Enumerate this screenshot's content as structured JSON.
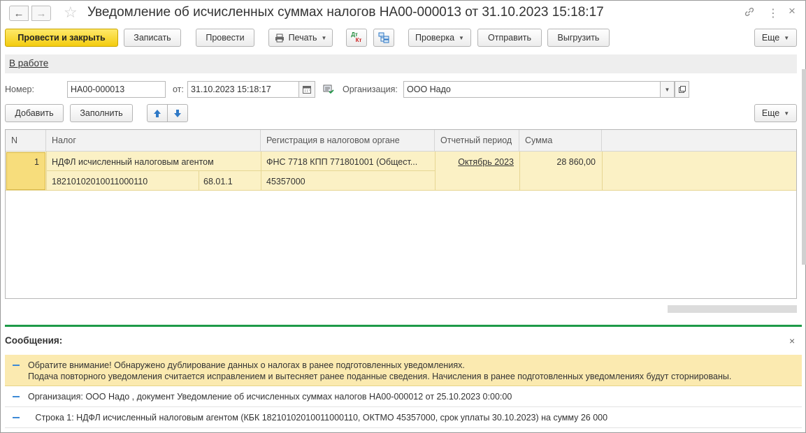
{
  "window": {
    "title": "Уведомление об исчисленных суммах налогов НА00-000013 от 31.10.2023 15:18:17",
    "back_icon": "←",
    "forward_icon": "→",
    "star_icon": "☆",
    "link_icon": "🔗",
    "menu_icon": "⋮",
    "close_icon": "×"
  },
  "toolbar": {
    "post_and_close": "Провести и закрыть",
    "save": "Записать",
    "post": "Провести",
    "print": "Печать",
    "dtkt_top": "Дт",
    "dtkt_bottom": "Кт",
    "check": "Проверка",
    "send": "Отправить",
    "export": "Выгрузить",
    "more": "Еще"
  },
  "status": {
    "label": "В работе"
  },
  "form": {
    "number_label": "Номер:",
    "number_value": "НА00-000013",
    "date_label": "от:",
    "date_value": "31.10.2023 15:18:17",
    "org_label": "Организация:",
    "org_value": "ООО Надо"
  },
  "table_toolbar": {
    "add": "Добавить",
    "fill": "Заполнить",
    "more": "Еще"
  },
  "table": {
    "columns": [
      "N",
      "Налог",
      "Регистрация в налоговом органе",
      "Отчетный период",
      "Сумма"
    ],
    "rows": [
      {
        "n": "1",
        "tax": "НДФЛ исчисленный налоговым агентом",
        "kbk": "18210102010011000110",
        "account": "68.01.1",
        "registration": "ФНС 7718 КПП 771801001 (Общест...",
        "oktmo": "45357000",
        "period": "Октябрь 2023",
        "sum": "28 860,00"
      }
    ]
  },
  "messages": {
    "title": "Сообщения:",
    "items": [
      {
        "line1": "Обратите внимание! Обнаружено дублирование данных о налогах в ранее подготовленных уведомлениях.",
        "line2": "Подача повторного уведомления считается исправлением и вытесняет ранее поданные сведения. Начисления в ранее подготовленных уведомлениях будут сторнированы."
      },
      {
        "line1": "Организация: ООО Надо , документ Уведомление об исчисленных суммах налогов НА00-000012 от 25.10.2023 0:00:00"
      },
      {
        "line1": "   Строка 1: НДФЛ исчисленный налоговым агентом (КБК 18210102010011000110, ОКТМО 45357000, срок уплаты 30.10.2023) на сумму 26 000"
      }
    ]
  },
  "colors": {
    "primary_button": "#f3cc0f",
    "selected_row": "#fbf1c5",
    "warning_message": "#fbeab0",
    "divider_green": "#1e9a48",
    "arrow_blue": "#2f79c6"
  }
}
